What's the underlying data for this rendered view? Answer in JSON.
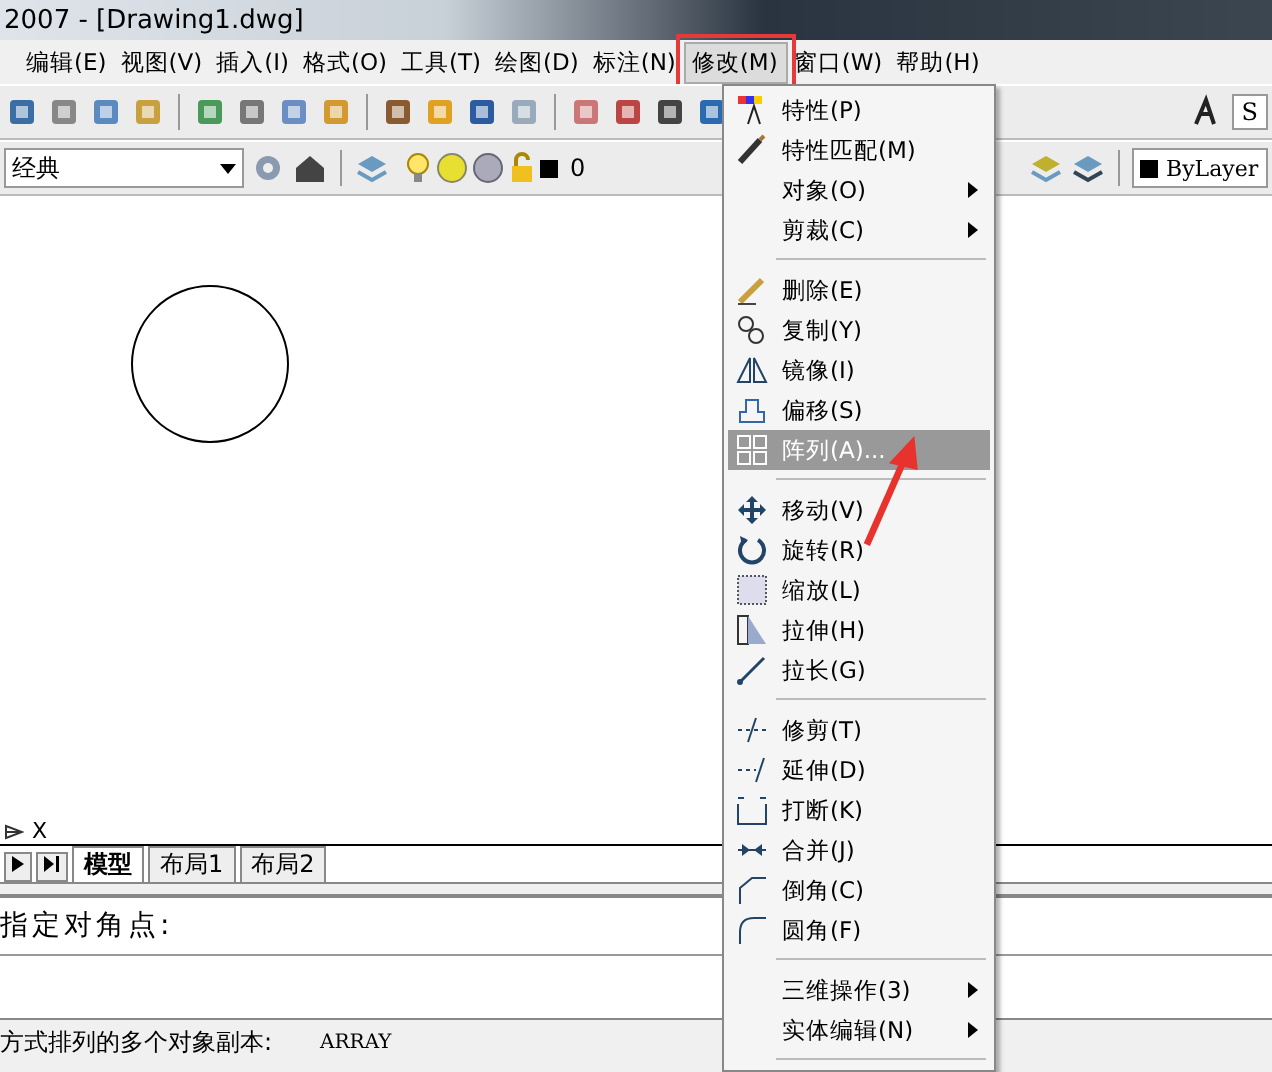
{
  "window": {
    "title": "2007 - [Drawing1.dwg]"
  },
  "menu_bar": [
    {
      "label": "编辑(E)",
      "selected": false
    },
    {
      "label": "视图(V)",
      "selected": false
    },
    {
      "label": "插入(I)",
      "selected": false
    },
    {
      "label": "格式(O)",
      "selected": false
    },
    {
      "label": "工具(T)",
      "selected": false
    },
    {
      "label": "绘图(D)",
      "selected": false
    },
    {
      "label": "标注(N)",
      "selected": false
    },
    {
      "label": "修改(M)",
      "selected": true
    },
    {
      "label": "窗口(W)",
      "selected": false
    },
    {
      "label": "帮助(H)",
      "selected": false
    }
  ],
  "toolbar": {
    "text_style": "S",
    "workspace": "经典",
    "layer": "0",
    "color_setting": "ByLayer"
  },
  "modify_menu": [
    {
      "kind": "item",
      "label": "特性(P)",
      "submenu": false,
      "selected": false
    },
    {
      "kind": "item",
      "label": "特性匹配(M)",
      "submenu": false,
      "selected": false
    },
    {
      "kind": "item",
      "label": "对象(O)",
      "submenu": true,
      "selected": false
    },
    {
      "kind": "item",
      "label": "剪裁(C)",
      "submenu": true,
      "selected": false
    },
    {
      "kind": "separator"
    },
    {
      "kind": "item",
      "label": "删除(E)",
      "submenu": false,
      "selected": false
    },
    {
      "kind": "item",
      "label": "复制(Y)",
      "submenu": false,
      "selected": false
    },
    {
      "kind": "item",
      "label": "镜像(I)",
      "submenu": false,
      "selected": false
    },
    {
      "kind": "item",
      "label": "偏移(S)",
      "submenu": false,
      "selected": false
    },
    {
      "kind": "item",
      "label": "阵列(A)...",
      "submenu": false,
      "selected": true
    },
    {
      "kind": "separator"
    },
    {
      "kind": "item",
      "label": "移动(V)",
      "submenu": false,
      "selected": false
    },
    {
      "kind": "item",
      "label": "旋转(R)",
      "submenu": false,
      "selected": false
    },
    {
      "kind": "item",
      "label": "缩放(L)",
      "submenu": false,
      "selected": false
    },
    {
      "kind": "item",
      "label": "拉伸(H)",
      "submenu": false,
      "selected": false
    },
    {
      "kind": "item",
      "label": "拉长(G)",
      "submenu": false,
      "selected": false
    },
    {
      "kind": "separator"
    },
    {
      "kind": "item",
      "label": "修剪(T)",
      "submenu": false,
      "selected": false
    },
    {
      "kind": "item",
      "label": "延伸(D)",
      "submenu": false,
      "selected": false
    },
    {
      "kind": "item",
      "label": "打断(K)",
      "submenu": false,
      "selected": false
    },
    {
      "kind": "item",
      "label": "合并(J)",
      "submenu": false,
      "selected": false
    },
    {
      "kind": "item",
      "label": "倒角(C)",
      "submenu": false,
      "selected": false
    },
    {
      "kind": "item",
      "label": "圆角(F)",
      "submenu": false,
      "selected": false
    },
    {
      "kind": "separator"
    },
    {
      "kind": "item",
      "label": "三维操作(3)",
      "submenu": true,
      "selected": false
    },
    {
      "kind": "item",
      "label": "实体编辑(N)",
      "submenu": true,
      "selected": false
    },
    {
      "kind": "separator"
    }
  ],
  "ucs": {
    "axis": "X"
  },
  "layout_tabs": [
    {
      "label": "模型",
      "selected": true
    },
    {
      "label": "布局1",
      "selected": false
    },
    {
      "label": "布局2",
      "selected": false
    }
  ],
  "command_line": {
    "history": "指定对角点:"
  },
  "status_bar": {
    "prompt": "方式排列的多个对象副本:",
    "command": "ARRAY"
  }
}
